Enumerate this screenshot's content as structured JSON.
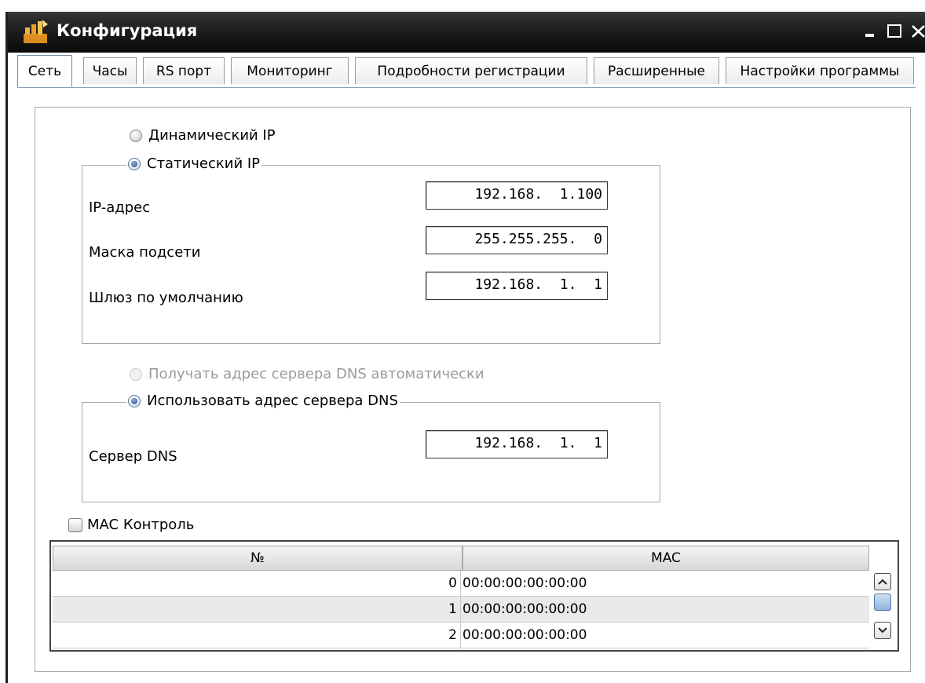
{
  "window": {
    "title": "Конфигурация",
    "controls": {
      "minimize": "minimize-icon",
      "maximize": "maximize-icon",
      "close": "close-icon"
    }
  },
  "tabs": [
    {
      "label": "Сеть",
      "active": true
    },
    {
      "label": "Часы",
      "active": false
    },
    {
      "label": "RS порт",
      "active": false
    },
    {
      "label": "Мониторинг",
      "active": false
    },
    {
      "label": "Подробности регистрации",
      "active": false
    },
    {
      "label": "Расширенные",
      "active": false
    },
    {
      "label": "Настройки программы",
      "active": false
    }
  ],
  "ip_mode": {
    "dynamic_label": "Динамический IP",
    "static_label": "Статический IP",
    "selected": "static"
  },
  "static_ip": {
    "ip_label": "IP-адрес",
    "ip_value": "192.168.  1.100",
    "mask_label": "Маска подсети",
    "mask_value": "255.255.255.  0",
    "gateway_label": "Шлюз по умолчанию",
    "gateway_value": "192.168.  1.  1"
  },
  "dns_mode": {
    "auto_label": "Получать адрес сервера DNS автоматически",
    "manual_label": "Использовать адрес сервера DNS",
    "selected": "manual",
    "auto_enabled": false
  },
  "dns": {
    "server_label": "Сервер DNS",
    "server_value": "192.168.  1.  1"
  },
  "mac_control": {
    "label": "MAC Контроль",
    "checked": false
  },
  "mac_table": {
    "columns": [
      "№",
      "MAC"
    ],
    "rows": [
      {
        "num": "0",
        "mac": "00:00:00:00:00:00"
      },
      {
        "num": "1",
        "mac": "00:00:00:00:00:00"
      },
      {
        "num": "2",
        "mac": "00:00:00:00:00:00"
      }
    ]
  },
  "colors": {
    "titlebar": "#1a1a1a",
    "accent": "#3f6a9c",
    "border": "#a8a8a8"
  }
}
